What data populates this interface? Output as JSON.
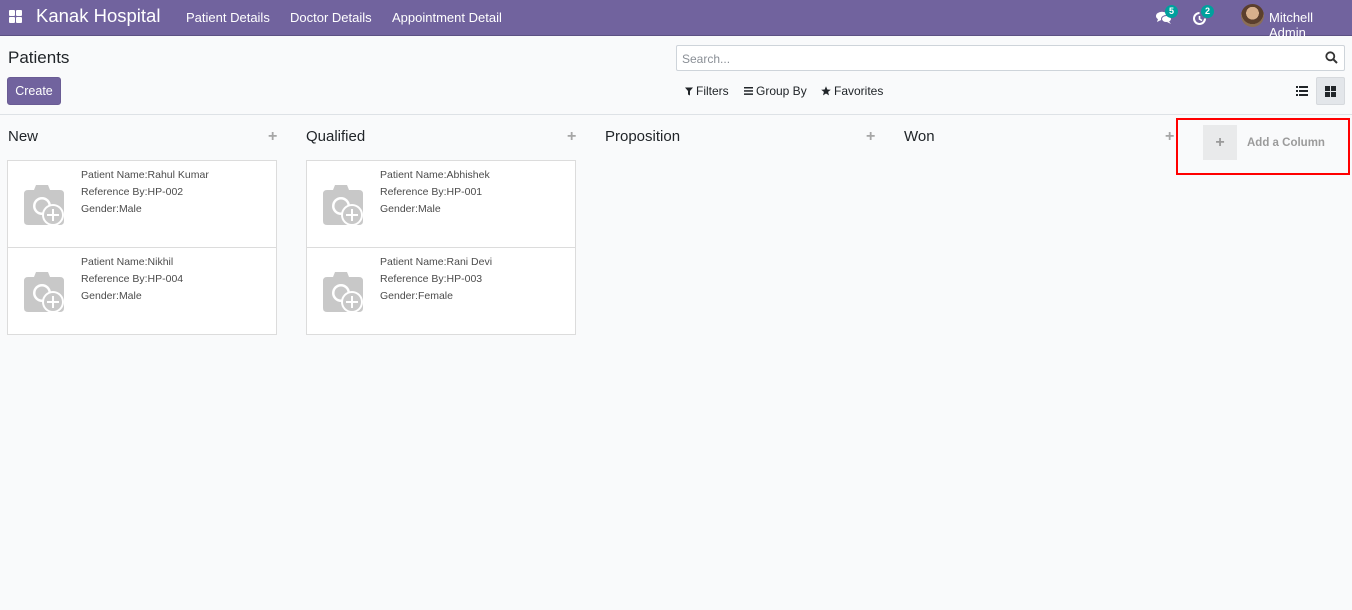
{
  "navbar": {
    "brand": "Kanak Hospital",
    "menu": [
      "Patient Details",
      "Doctor Details",
      "Appointment Detail"
    ],
    "messages_count": "5",
    "activities_count": "2",
    "user_name": "Mitchell Admin",
    "bg_color": "#71639e",
    "badge_color": "#00a09d"
  },
  "control_panel": {
    "title": "Patients",
    "create_label": "Create",
    "search_placeholder": "Search...",
    "filters_label": "Filters",
    "group_by_label": "Group By",
    "favorites_label": "Favorites",
    "active_view": "kanban"
  },
  "kanban": {
    "columns": [
      {
        "title": "New",
        "cards": [
          {
            "name": "Patient Name:Rahul Kumar",
            "reference": "Reference By:HP-002",
            "gender": "Gender:Male"
          },
          {
            "name": "Patient Name:Nikhil",
            "reference": "Reference By:HP-004",
            "gender": "Gender:Male"
          }
        ]
      },
      {
        "title": "Qualified",
        "cards": [
          {
            "name": "Patient Name:Abhishek",
            "reference": "Reference By:HP-001",
            "gender": "Gender:Male"
          },
          {
            "name": "Patient Name:Rani Devi",
            "reference": "Reference By:HP-003",
            "gender": "Gender:Female"
          }
        ]
      },
      {
        "title": "Proposition",
        "cards": []
      },
      {
        "title": "Won",
        "cards": []
      }
    ],
    "add_column_label": "Add a Column",
    "highlight_color": "#ff0000"
  }
}
